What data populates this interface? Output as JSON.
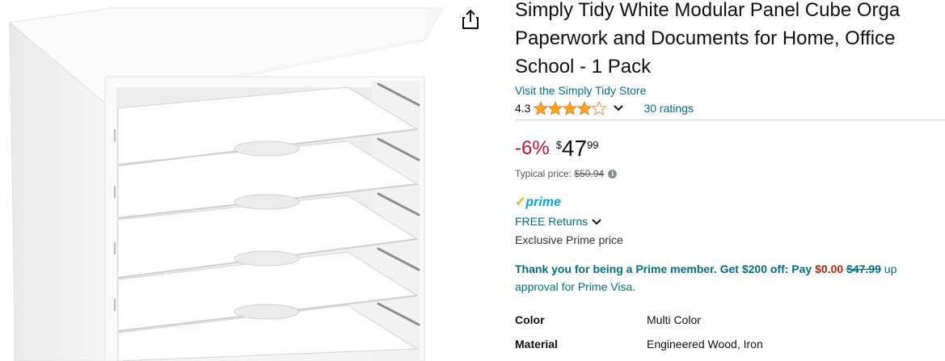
{
  "product": {
    "title_lines": [
      "Simply Tidy White Modular Panel Cube Orga",
      "Paperwork and Documents for Home, Office",
      "School - 1 Pack"
    ],
    "store_link": "Visit the Simply Tidy Store",
    "rating_value": "4.3",
    "rating_stars": 4.3,
    "ratings_count": "30 ratings",
    "discount": "-6%",
    "currency": "$",
    "price_whole": "47",
    "price_fraction": "99",
    "typical_label": "Typical price:",
    "typical_price": "$50.94",
    "prime_label": "prime",
    "free_returns": "FREE Returns",
    "exclusive": "Exclusive Prime price",
    "promo": {
      "text1": "Thank you for being a Prime member. Get $200 off: Pay",
      "pay_amount": "$0.00",
      "old_amount": "$47.99",
      "text2": "up",
      "line2": "approval for Prime Visa."
    },
    "specs": [
      {
        "key": "Color",
        "value": "Multi Color"
      },
      {
        "key": "Material",
        "value": "Engineered Wood, Iron"
      }
    ]
  },
  "icons": {
    "share": "share-icon",
    "star": "star-icon",
    "chevron": "chevron-down-icon",
    "info": "info-icon"
  },
  "colors": {
    "link": "#007185",
    "discount": "#cc0c39",
    "star": "#ffa41c",
    "prime_blue": "#00a8e1",
    "promo_red": "#b12704"
  }
}
